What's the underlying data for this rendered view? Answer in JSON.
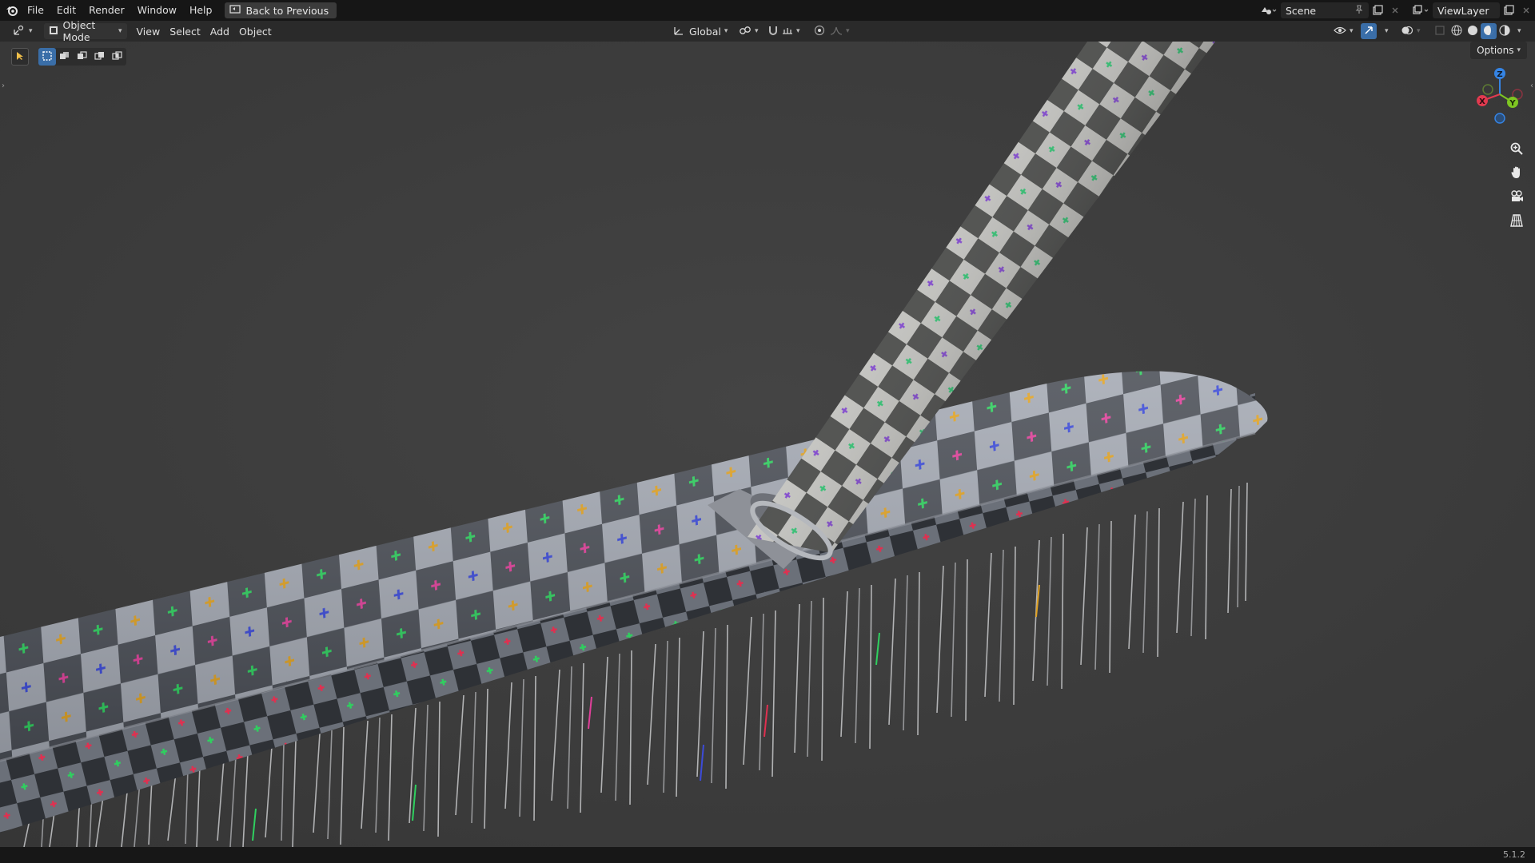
{
  "menubar": {
    "items": [
      "File",
      "Edit",
      "Render",
      "Window",
      "Help"
    ],
    "back_label": "Back to Previous",
    "scene_name": "Scene",
    "view_layer": "ViewLayer"
  },
  "header": {
    "mode": "Object Mode",
    "menus": [
      "View",
      "Select",
      "Add",
      "Object"
    ],
    "transform_orientation": "Global"
  },
  "viewport": {
    "options_label": "Options",
    "gizmo_axes": [
      "X",
      "Y",
      "Z"
    ],
    "nav_tools": [
      "zoom-icon",
      "pan-hand-icon",
      "camera-icon",
      "grid-icon"
    ]
  },
  "statusbar": {
    "version": "5.1.2"
  },
  "colors": {
    "accent": "#3a6ea8",
    "axis_x": "#e23a4f",
    "axis_y": "#7ec622",
    "axis_z": "#3584e4",
    "viewport_bg": "#3d3d3d"
  }
}
